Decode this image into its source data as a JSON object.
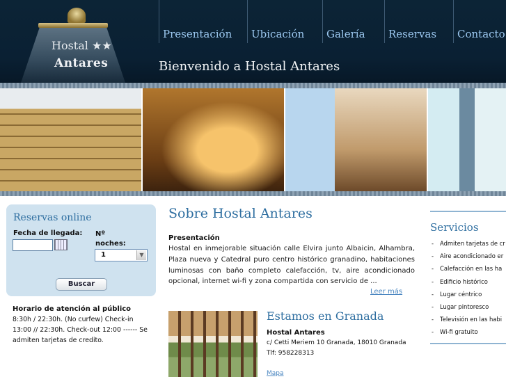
{
  "header": {
    "logo_line1": "Hostal ★★",
    "logo_line2": "Antares",
    "nav": [
      "Presentación",
      "Ubicación",
      "Galería",
      "Reservas",
      "Contacto"
    ],
    "welcome": "Bienvenido a Hostal Antares"
  },
  "booking": {
    "title": "Reservas online",
    "date_label": "Fecha de llegada:",
    "date_value": "",
    "nights_label": "Nº noches:",
    "nights_value": "1",
    "button": "Buscar"
  },
  "hours": {
    "title": "Horario de atención al público",
    "text": "8:30h / 22:30h. (No curfew) Check-in 13:00 // 22:30h. Check-out 12:00 ------ Se admiten tarjetas de credito."
  },
  "about": {
    "title": "Sobre Hostal Antares",
    "subtitle": "Presentación",
    "body": "Hostal en inmejorable situación calle Elvira junto Albaicin, Alhambra, Plaza nueva y Catedral puro centro histórico granadino, habitaciones luminosas con baño completo calefacción, tv, aire acondicionado opcional, internet wi-fi y zona compartida con servicio de ...",
    "more": "Leer más"
  },
  "granada": {
    "title": "Estamos en Granada",
    "name": "Hostal Antares",
    "address": "c/ Cetti Meriem 10 Granada, 18010 Granada",
    "phone": "Tlf: 958228313",
    "map_link": "Mapa"
  },
  "services": {
    "title": "Servicios",
    "items": [
      "Admiten tarjetas de cr",
      "Aire acondicionado er",
      "Calefacción en las ha",
      "Edificio histórico",
      "Lugar céntrico",
      "Lugar pintoresco",
      "Televisión en las habi",
      "Wi-fi gratuito"
    ]
  }
}
